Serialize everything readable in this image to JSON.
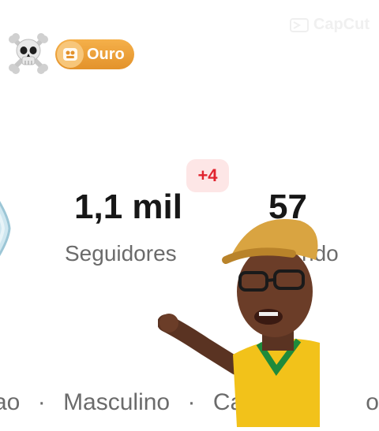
{
  "header": {
    "rank_badge_label": "Ouro",
    "watermark_label": "CapCut"
  },
  "stats": {
    "new_followers_badge": "+4",
    "followers_value": "1,1 mil",
    "followers_label": "Seguidores",
    "following_value": "57",
    "following_label_partial": "ndo"
  },
  "profile_info": {
    "location_partial": "ao",
    "gender": "Masculino",
    "extra_partial": "Cap",
    "extra_tail": "o",
    "separator": "·"
  },
  "colors": {
    "accent_badge": "#e3922b",
    "new_badge_text": "#e1242f",
    "new_badge_bg": "#fde6e6"
  },
  "icons": {
    "skull": "skull-crossbones-icon",
    "rank": "gold-rank-icon",
    "watermark": "capcut-logo-icon"
  }
}
